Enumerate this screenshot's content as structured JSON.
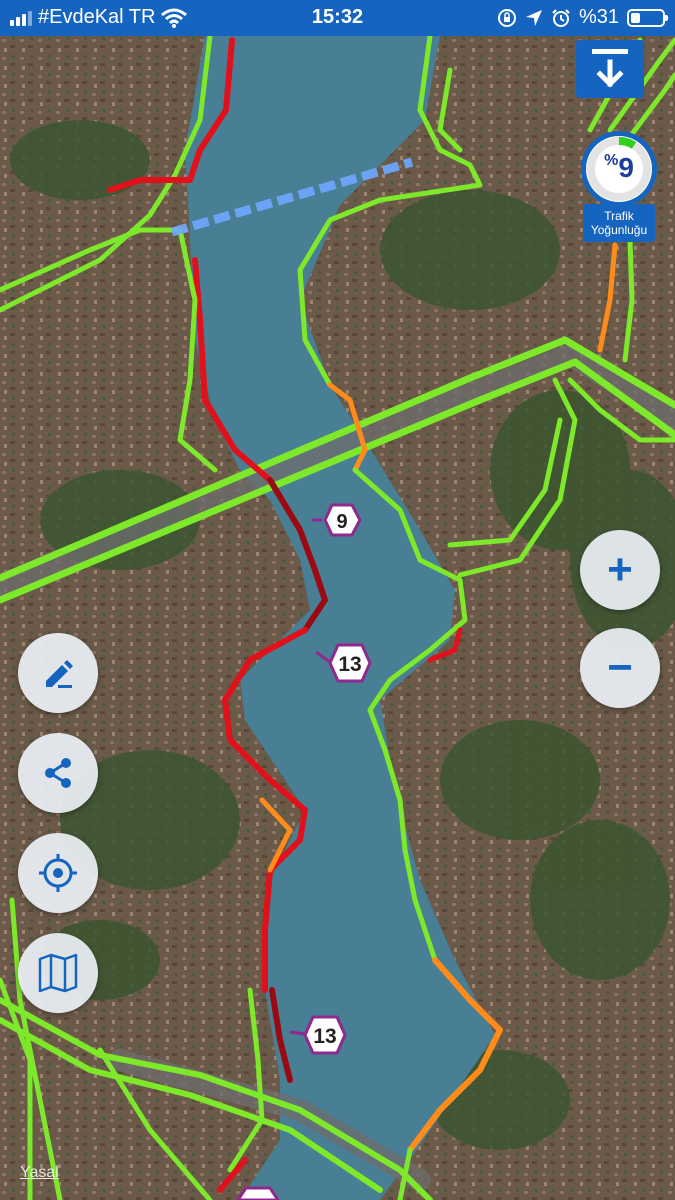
{
  "status_bar": {
    "carrier": "#EvdeKal TR",
    "time": "15:32",
    "battery": "%31",
    "battery_level": 0.31
  },
  "traffic_density": {
    "percent_symbol": "%",
    "value": "9",
    "label_line1": "Trafik",
    "label_line2": "Yoğunluğu"
  },
  "speed_markers": [
    "9",
    "13",
    "13"
  ],
  "controls": {
    "download_icon": "download-icon",
    "zoom_in": "+",
    "zoom_out": "−",
    "edit_icon": "pencil-icon",
    "share_icon": "share-icon",
    "locate_icon": "crosshair-icon",
    "layers_icon": "map-icon"
  },
  "legal_link": "Yasal",
  "traffic_colors": {
    "free": "#7ee82a",
    "slow": "#ff8c1a",
    "heavy": "#e0111b",
    "jam": "#9b0a12",
    "accent": "#1565c0"
  }
}
